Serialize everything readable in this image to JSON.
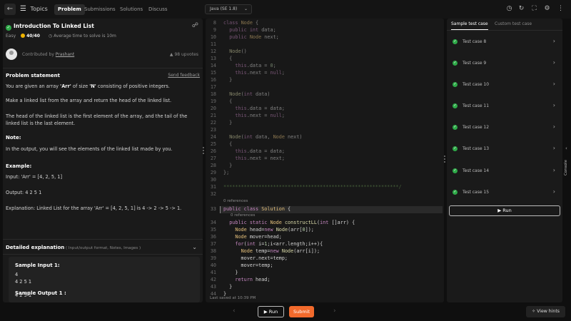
{
  "topbar": {
    "topics_label": "Topics",
    "tabs": [
      "Problem",
      "Submissions",
      "Solutions",
      "Discuss"
    ],
    "language": "Java (SE 1.8)",
    "icons": [
      "timer-icon",
      "refresh-icon",
      "fullscreen-icon",
      "settings-icon",
      "more-icon"
    ]
  },
  "problem": {
    "title": "Introduction To Linked List",
    "difficulty": "Easy",
    "score": "40/40",
    "avg_time": "Average time to solve is 10m",
    "contributed_prefix": "Contributed by ",
    "contributor": "Prashant",
    "upvotes": "98 upvotes",
    "statement_heading": "Problem statement",
    "send_feedback": "Send feedback",
    "para1_a": "You are given an array ",
    "para1_b": "'Arr'",
    "para1_c": " of size ",
    "para1_d": "'N'",
    "para1_e": " consisting of positive integers.",
    "para2": "Make a linked list from the array and return the head of the linked list.",
    "para3": "The head of the linked list is the first element of the array, and the tail of the linked list is the last element.",
    "note_heading": "Note:",
    "note_text": "In the output, you will see the elements of the linked list made by you.",
    "example_heading": "Example:",
    "example_input": "Input: 'Arr' = [4, 2, 5, 1]",
    "example_output": "Output: 4 2 5 1",
    "example_expl": "Explanation: Linked List for the array 'Arr' = [4, 2, 5, 1] is 4 -> 2 -> 5 -> 1.",
    "detail_label": "Detailed explanation",
    "detail_sub": " ( Input/output format, Notes, Images )",
    "sample_input_heading": "Sample Input 1:",
    "sample_input_l1": "4",
    "sample_input_l2": "4 2 5 1",
    "sample_output_heading": "Sample Output 1 :",
    "sample_output_l1": "4 2 5 1"
  },
  "editor": {
    "refs_label": "0 references",
    "last_saved": "Last saved at 10:39 PM"
  },
  "tests": {
    "tab_sample": "Sample test case",
    "tab_custom": "Custom test case",
    "cases": [
      "Test case 8",
      "Test case 9",
      "Test case 10",
      "Test case 11",
      "Test case 12",
      "Test case 13",
      "Test case 14",
      "Test case 15"
    ],
    "run_label": "Run",
    "console_label": "Console"
  },
  "bottom": {
    "run_label": "Run",
    "submit_label": "Submit",
    "hints_label": "View hints"
  },
  "colors": {
    "accent_submit": "#f26a2c",
    "success": "#2eaa48",
    "panel_bg": "#1a1a1a"
  }
}
